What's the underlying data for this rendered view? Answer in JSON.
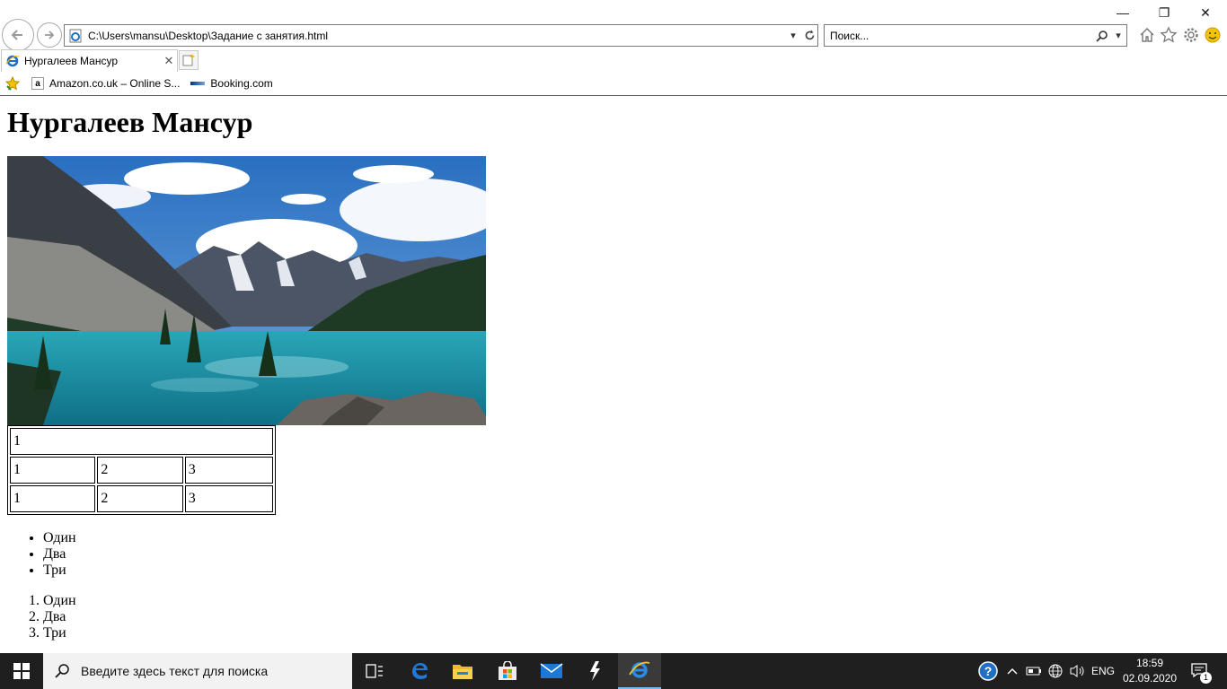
{
  "window": {
    "controls": {
      "minimize": "—",
      "restore": "❐",
      "close": "✕"
    }
  },
  "toolbar": {
    "address": "C:\\Users\\mansu\\Desktop\\Задание с занятия.html",
    "search_placeholder": "Поиск...",
    "icons": [
      "back-icon",
      "forward-icon",
      "ie-page-icon",
      "dropdown-icon",
      "refresh-icon",
      "search-icon",
      "home-icon",
      "favorites-star-icon",
      "settings-gear-icon",
      "feedback-smiley-icon"
    ]
  },
  "tab": {
    "title": "Нургалеев Мансур",
    "close": "✕"
  },
  "favorites": [
    {
      "label": "Amazon.co.uk – Online S...",
      "icon": "amazon-icon"
    },
    {
      "label": "Booking.com",
      "icon": "booking-icon"
    }
  ],
  "page": {
    "heading": "Нургалеев Мансур",
    "image": "mountain-lake-photo",
    "table": {
      "row1": [
        "1"
      ],
      "row2": [
        "1",
        "2",
        "3"
      ],
      "row3": [
        "1",
        "2",
        "3"
      ]
    },
    "bullet_list": [
      "Один",
      "Два",
      "Три"
    ],
    "ordered_list": [
      "Один",
      "Два",
      "Три"
    ]
  },
  "taskbar": {
    "search_placeholder": "Введите здесь текст для поиска",
    "apps": [
      "task-view-icon",
      "edge-icon",
      "file-explorer-icon",
      "store-icon",
      "mail-icon",
      "app-icon",
      "internet-explorer-icon"
    ],
    "tray": {
      "language": "ENG",
      "time": "18:59",
      "date": "02.09.2020",
      "notifications": "1"
    }
  },
  "colors": {
    "taskbar": "#1f1f1f",
    "ie_blue": "#1e6fc5",
    "active_app_underline": "#76b9ed"
  }
}
